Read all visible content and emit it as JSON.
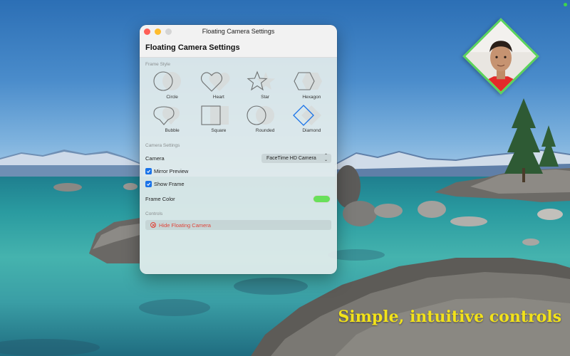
{
  "window": {
    "title": "Floating Camera Settings",
    "header_title": "Floating Camera Settings"
  },
  "frame_style": {
    "section_label": "Frame Style",
    "items": [
      {
        "label": "Circle",
        "icon": "circle-frame-icon",
        "selected": false
      },
      {
        "label": "Heart",
        "icon": "heart-frame-icon",
        "selected": false
      },
      {
        "label": "Star",
        "icon": "star-frame-icon",
        "selected": false
      },
      {
        "label": "Hexagon",
        "icon": "hexagon-frame-icon",
        "selected": false
      },
      {
        "label": "Bubble",
        "icon": "bubble-frame-icon",
        "selected": false
      },
      {
        "label": "Square",
        "icon": "square-frame-icon",
        "selected": false
      },
      {
        "label": "Rounded",
        "icon": "rounded-frame-icon",
        "selected": false
      },
      {
        "label": "Diamond",
        "icon": "diamond-frame-icon",
        "selected": true
      }
    ]
  },
  "camera_settings": {
    "section_label": "Camera Settings",
    "camera_label": "Camera",
    "camera_value": "FaceTime HD Camera",
    "mirror_label": "Mirror Preview",
    "mirror_checked": true,
    "show_frame_label": "Show Frame",
    "show_frame_checked": true,
    "frame_color_label": "Frame Color",
    "frame_color": "#68e05a"
  },
  "controls": {
    "section_label": "Controls",
    "hide_label": "Hide Floating Camera"
  },
  "tagline": "Simple, intuitive controls",
  "colors": {
    "accent_blue": "#1a73e8",
    "danger_red": "#e0443a",
    "frame_green": "#5bd45b",
    "tagline_yellow": "#f2e21a"
  }
}
